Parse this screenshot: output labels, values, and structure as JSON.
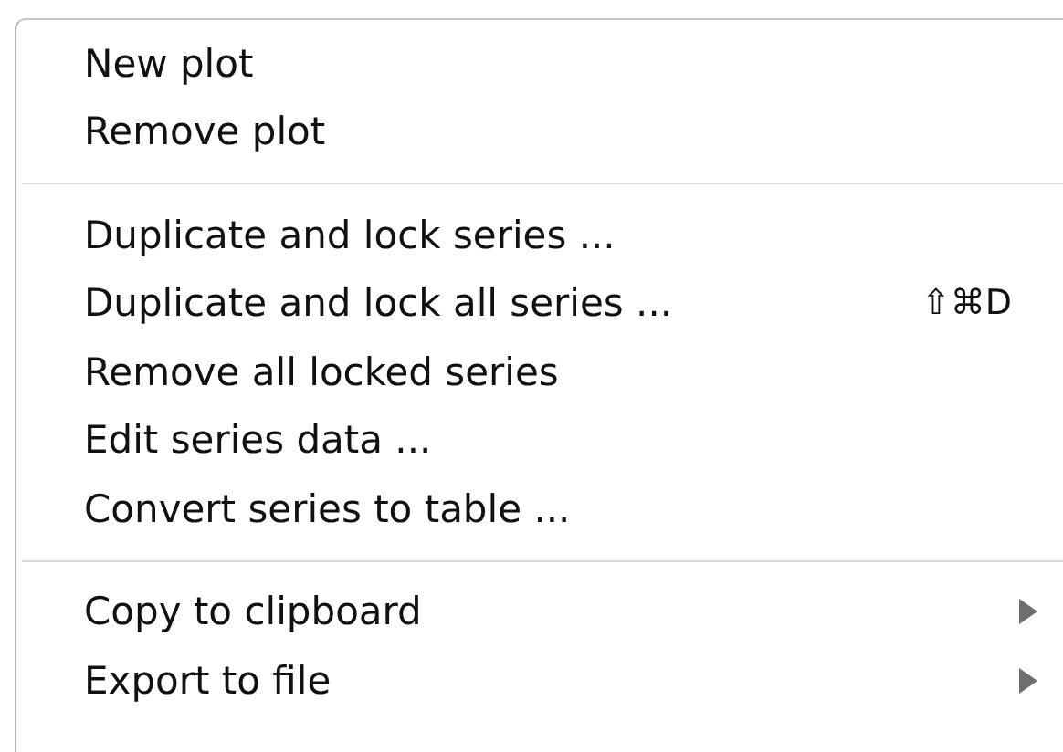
{
  "menu": {
    "sections": [
      {
        "items": [
          {
            "label": "New plot"
          },
          {
            "label": "Remove plot"
          }
        ]
      },
      {
        "items": [
          {
            "label": "Duplicate and lock series ..."
          },
          {
            "label": "Duplicate and lock all series ...",
            "shortcut": "⇧⌘D"
          },
          {
            "label": "Remove all locked series"
          },
          {
            "label": "Edit series data ..."
          },
          {
            "label": "Convert series to table ..."
          }
        ]
      },
      {
        "items": [
          {
            "label": "Copy to clipboard",
            "submenu": true
          },
          {
            "label": "Export to file",
            "submenu": true
          }
        ]
      }
    ]
  }
}
